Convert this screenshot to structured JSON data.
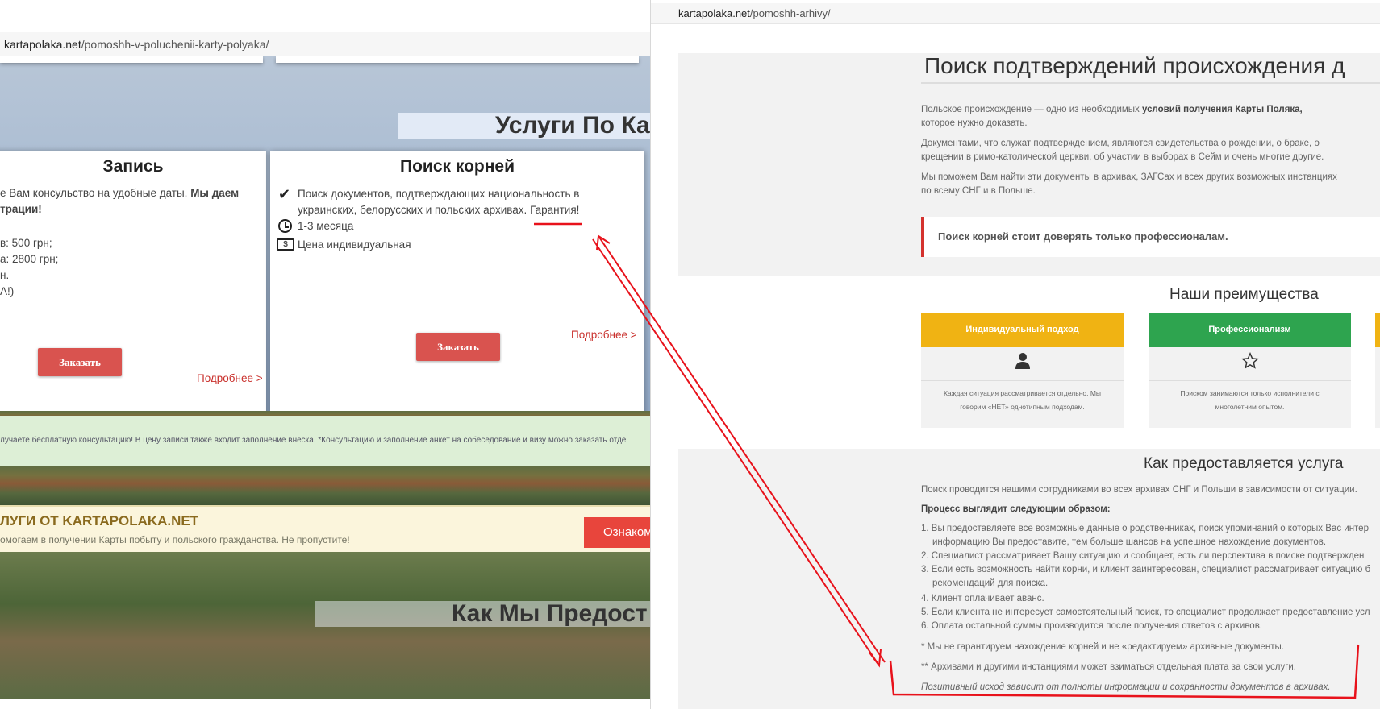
{
  "left_window": {
    "url_domain": "kartapolaka.net",
    "url_path": "/pomoshh-v-poluchenii-karty-polyaka/",
    "services_banner": "Услуги По Ка",
    "card_zapis": {
      "title": "Запись",
      "line1_a": "е Вам консульство на удобные даты. ",
      "line1_b": "Мы даем",
      "line2": "трации!",
      "line3": "в: 500 грн;",
      "line4": "а: 2800 грн;",
      "line5": "н.",
      "line6": "А!)",
      "more": "Подробнее >",
      "order": "Заказать"
    },
    "card_poisk": {
      "title": "Поиск корней",
      "bullet1": "Поиск документов, подтверждающих национальность в украинских, белорусских и польских архивах.",
      "bullet1_link": "Гарантия!",
      "bullet2": "1-3 месяца",
      "bullet3": "Цена индивидуальная",
      "more": "Подробнее >",
      "order": "Заказать"
    },
    "green_note": "лучаете бесплатную консультацию! В цену записи также входит заполнение внеска. *Консультацию и заполнение анкет на собеседование и визу можно заказать отде",
    "cream_title": "ЛУГИ ОТ KARTAPOLAKA.NET",
    "cream_sub": "омогаем в получении Карты побыту и польского гражданства. Не пропустите!",
    "acquaint_button": "Ознаком",
    "how_banner": "Как Мы Предост"
  },
  "right_window": {
    "url_domain": "kartapolaka.net",
    "url_path": "/pomoshh-arhivy/",
    "title": "Поиск подтверждений происхождения д",
    "p1_a": "Польское происхождение — одно из необходимых ",
    "p1_b": "условий получения Карты Поляка,",
    "p1_c": "которое нужно доказать.",
    "p2": "Документами, что служат подтверждением, являются свидетельства о рождении, о браке, о крещении в римо-католической церкви, об участии в выборах в Сейм и очень многие другие.",
    "p3": "Мы поможем Вам найти эти документы в архивах, ЗАГСах и всех других возможных инстанциях по всему СНГ и в Польше.",
    "quote": "Поиск корней стоит доверять только профессионалам.",
    "advantages_title": "Наши преимущества",
    "advantages": [
      {
        "title": "Индивидуальный подход",
        "icon": "user-icon",
        "color": "#f0b313",
        "desc": "Каждая ситуация рассматривается отдельно. Мы говорим «НЕТ» однотипным подходам."
      },
      {
        "title": "Профессионализм",
        "icon": "star-icon",
        "color": "#2ea44f",
        "desc": "Поиском занимаются только исполнители с многолетним опытом."
      }
    ],
    "how_title": "Как предоставляется услуга",
    "how_intro": "Поиск проводится нашими сотрудниками во всех архивах СНГ и Польши в зависимости от ситуации.",
    "process_title": "Процесс выглядит следующим образом:",
    "steps": [
      "1. Вы предоставляете все возможные данные о родственниках, поиск упоминаний о которых Вас интер",
      "информацию Вы предоставите, тем больше шансов на успешное нахождение документов.",
      "2. Специалист рассматривает Вашу ситуацию и сообщает, есть ли перспектива в поиске подтвержден",
      "3. Если есть возможность найти корни, и клиент заинтересован, специалист рассматривает ситуацию б",
      "рекомендаций для поиска.",
      "4. Клиент оплачивает аванс.",
      "5. Если клиента не интересует самостоятельный поиск, то специалист продолжает предоставление усл",
      "6. Оплата остальной суммы производится после получения ответов с архивов."
    ],
    "note1": "* Мы не гарантируем нахождение корней и не «редактируем» архивные документы.",
    "note2": "** Архивами и другими инстанциями может взиматься отдельная плата за свои услуги.",
    "note3": "Позитивный исход зависит от полноты информации и сохранности документов в архивах."
  },
  "colors": {
    "annotation_red": "#e8121b",
    "order_button": "#d9534f",
    "quote_border": "#d4322e",
    "adv_yellow": "#f0b313",
    "adv_green": "#2ea44f"
  }
}
